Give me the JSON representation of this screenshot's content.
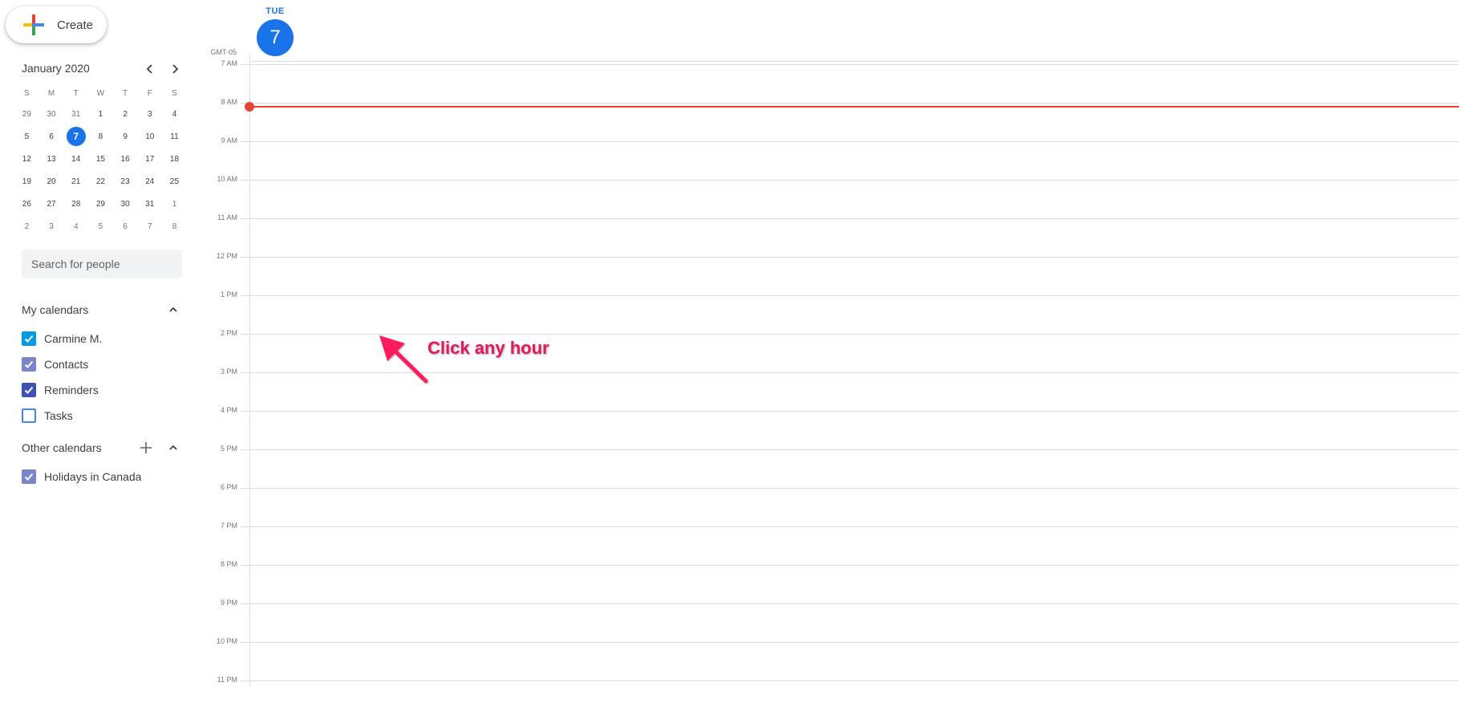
{
  "sidebar": {
    "create_label": "Create",
    "mini_calendar": {
      "title": "January 2020",
      "prev_icon": "chevron-left-icon",
      "next_icon": "chevron-right-icon",
      "weekday_headers": [
        "S",
        "M",
        "T",
        "W",
        "T",
        "F",
        "S"
      ],
      "weeks": [
        [
          {
            "d": "29",
            "muted": true
          },
          {
            "d": "30",
            "muted": true
          },
          {
            "d": "31",
            "muted": true
          },
          {
            "d": "1"
          },
          {
            "d": "2"
          },
          {
            "d": "3"
          },
          {
            "d": "4"
          }
        ],
        [
          {
            "d": "5"
          },
          {
            "d": "6"
          },
          {
            "d": "7",
            "today": true
          },
          {
            "d": "8"
          },
          {
            "d": "9"
          },
          {
            "d": "10"
          },
          {
            "d": "11"
          }
        ],
        [
          {
            "d": "12"
          },
          {
            "d": "13"
          },
          {
            "d": "14"
          },
          {
            "d": "15"
          },
          {
            "d": "16"
          },
          {
            "d": "17"
          },
          {
            "d": "18"
          }
        ],
        [
          {
            "d": "19"
          },
          {
            "d": "20"
          },
          {
            "d": "21"
          },
          {
            "d": "22"
          },
          {
            "d": "23"
          },
          {
            "d": "24"
          },
          {
            "d": "25"
          }
        ],
        [
          {
            "d": "26"
          },
          {
            "d": "27"
          },
          {
            "d": "28"
          },
          {
            "d": "29"
          },
          {
            "d": "30"
          },
          {
            "d": "31"
          },
          {
            "d": "1",
            "muted": true
          }
        ],
        [
          {
            "d": "2",
            "muted": true
          },
          {
            "d": "3",
            "muted": true
          },
          {
            "d": "4",
            "muted": true
          },
          {
            "d": "5",
            "muted": true
          },
          {
            "d": "6",
            "muted": true
          },
          {
            "d": "7",
            "muted": true
          },
          {
            "d": "8",
            "muted": true
          }
        ]
      ]
    },
    "search_placeholder": "Search for people",
    "my_calendars": {
      "title": "My calendars",
      "items": [
        {
          "label": "Carmine M.",
          "checked": true,
          "color": "#039be5"
        },
        {
          "label": "Contacts",
          "checked": true,
          "color": "#7986cb"
        },
        {
          "label": "Reminders",
          "checked": true,
          "color": "#3f51b5"
        },
        {
          "label": "Tasks",
          "checked": false,
          "color": "#4285f4"
        }
      ]
    },
    "other_calendars": {
      "title": "Other calendars",
      "items": [
        {
          "label": "Holidays in Canada",
          "checked": true,
          "color": "#7986cb"
        }
      ]
    }
  },
  "main": {
    "day_of_week": "TUE",
    "day_number": "7",
    "timezone": "GMT-05",
    "hours": [
      "7 AM",
      "8 AM",
      "9 AM",
      "10 AM",
      "11 AM",
      "12 PM",
      "1 PM",
      "2 PM",
      "3 PM",
      "4 PM",
      "5 PM",
      "6 PM",
      "7 PM",
      "8 PM",
      "9 PM",
      "10 PM",
      "11 PM"
    ],
    "current_time_hours_after_first": 1.1
  },
  "annotation": {
    "text": "Click any hour",
    "color": "#e5175e"
  },
  "colors": {
    "accent": "#1a73e8",
    "now_indicator": "#ea4335"
  }
}
